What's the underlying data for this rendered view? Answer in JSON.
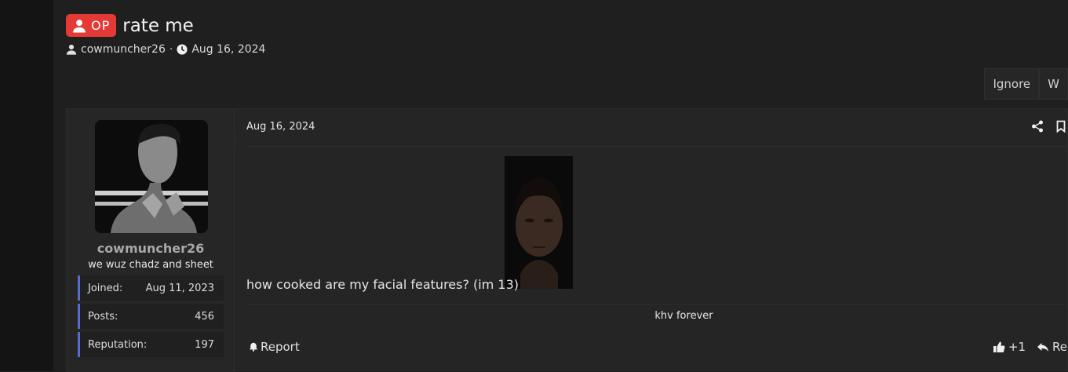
{
  "thread": {
    "badge": "OP",
    "title": "rate me",
    "author": "cowmuncher26",
    "separator": "·",
    "date": "Aug 16, 2024"
  },
  "top_actions": [
    "Ignore",
    "W"
  ],
  "post": {
    "date": "Aug 16, 2024",
    "text": "how cooked are my facial features? (im 13)",
    "signature": "khv forever",
    "report_label": "Report",
    "reaction_count": "+1",
    "reply_label": "Re"
  },
  "user": {
    "name": "cowmuncher26",
    "title": "we wuz chadz and sheet",
    "stats": [
      {
        "label": "Joined:",
        "value": "Aug 11, 2023"
      },
      {
        "label": "Posts:",
        "value": "456"
      },
      {
        "label": "Reputation:",
        "value": "197"
      }
    ]
  },
  "icons": {
    "user": "user-icon",
    "clock": "clock-icon",
    "share": "share-icon",
    "bookmark": "bookmark-icon",
    "bell": "bell-icon",
    "thumbs_up": "thumbs-up-icon",
    "reply": "reply-icon"
  },
  "colors": {
    "op_badge": "#e53935",
    "stat_accent": "#5a6bd1"
  }
}
